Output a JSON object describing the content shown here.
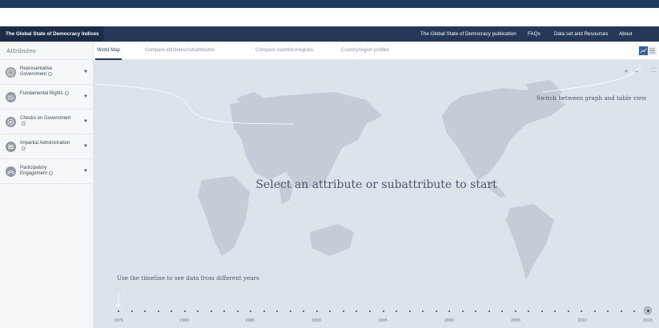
{
  "navbar": {
    "brand": "The Global State of Democracy Indices",
    "links": [
      "The Global State of Democracy publication",
      "FAQs",
      "Data set and Resources",
      "About"
    ]
  },
  "sidebar": {
    "title": "Attributes",
    "items": [
      {
        "label": "Representative Government",
        "icon": "representative-government-icon"
      },
      {
        "label": "Fundamental Rights",
        "icon": "fundamental-rights-icon"
      },
      {
        "label": "Checks on Government",
        "icon": "checks-on-government-icon"
      },
      {
        "label": "Impartial Administration",
        "icon": "impartial-administration-icon"
      },
      {
        "label": "Participatory Engagement",
        "icon": "participatory-engagement-icon"
      }
    ]
  },
  "tabs": [
    "World Map",
    "Compare attributes/subattributes",
    "Compare countries/regions",
    "Country/region profiles"
  ],
  "active_tab": "World Map",
  "map": {
    "message": "Select an attribute or subattribute to start",
    "hint_toggle": "Switch between graph and table view",
    "hint_timeline": "Use the timeline to see data from different years",
    "zoom_in": "+",
    "zoom_out": "−"
  },
  "timeline": {
    "years": [
      "1975",
      "1980",
      "1985",
      "1990",
      "1995",
      "2000",
      "2005",
      "2010",
      "2015"
    ],
    "selected_year": "2015"
  },
  "colors": {
    "navbar": "#253858",
    "brand_bg": "#1a2c47",
    "map_bg": "#dde3ea",
    "land": "#c3ccd7",
    "accent": "#3c5f94"
  }
}
